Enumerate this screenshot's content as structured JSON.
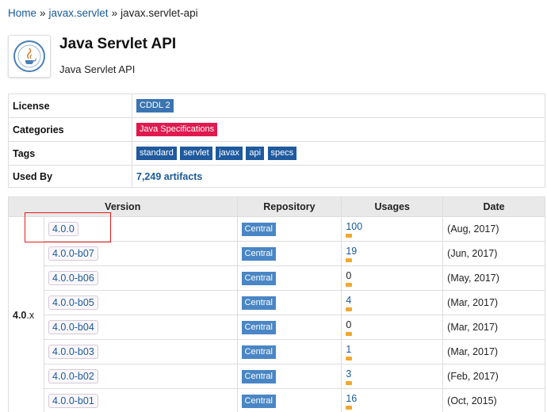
{
  "breadcrumb": {
    "home": "Home",
    "sep1": "»",
    "group": "javax.servlet",
    "sep2": "»",
    "current": "javax.servlet-api"
  },
  "header": {
    "title": "Java Servlet API",
    "subtitle": "Java Servlet API",
    "logo_icon": "java-community-process-logo"
  },
  "info": {
    "license_label": "License",
    "license": "CDDL 2",
    "categories_label": "Categories",
    "category": "Java Specifications",
    "tags_label": "Tags",
    "tags": [
      "standard",
      "servlet",
      "javax",
      "api",
      "specs"
    ],
    "usedby_label": "Used By",
    "usedby": "7,249 artifacts"
  },
  "versions": {
    "headers": {
      "version": "Version",
      "repository": "Repository",
      "usages": "Usages",
      "date": "Date"
    },
    "group_major": "4.0",
    "group_suffix": ".x",
    "rows": [
      {
        "version": "4.0.0",
        "repo": "Central",
        "usages": "100",
        "date": "(Aug, 2017)"
      },
      {
        "version": "4.0.0-b07",
        "repo": "Central",
        "usages": "19",
        "date": "(Jun, 2017)"
      },
      {
        "version": "4.0.0-b06",
        "repo": "Central",
        "usages": "0",
        "date": "(May, 2017)"
      },
      {
        "version": "4.0.0-b05",
        "repo": "Central",
        "usages": "4",
        "date": "(Mar, 2017)"
      },
      {
        "version": "4.0.0-b04",
        "repo": "Central",
        "usages": "0",
        "date": "(Mar, 2017)"
      },
      {
        "version": "4.0.0-b03",
        "repo": "Central",
        "usages": "1",
        "date": "(Mar, 2017)"
      },
      {
        "version": "4.0.0-b02",
        "repo": "Central",
        "usages": "3",
        "date": "(Feb, 2017)"
      },
      {
        "version": "4.0.0-b01",
        "repo": "Central",
        "usages": "16",
        "date": "(Oct, 2015)"
      }
    ]
  },
  "colors": {
    "link": "#1a5a99",
    "license_tag": "#3a75b2",
    "category_tag": "#e0194e",
    "tag": "#1f5a9e",
    "usage_bar": "#f0a830",
    "highlight": "#e21b1b"
  }
}
